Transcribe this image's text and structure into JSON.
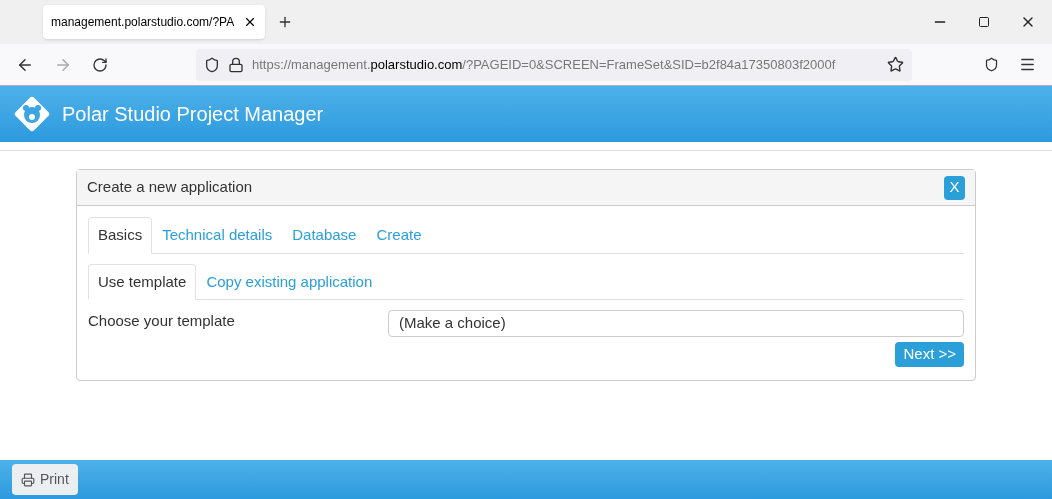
{
  "browser": {
    "tab_title": "management.polarstudio.com/?PA",
    "url": {
      "prefix": "https://management.",
      "domain": "polarstudio.com",
      "rest": "/?PAGEID=0&SCREEN=FrameSet&SID=b2f84a17350803f2000f"
    }
  },
  "header": {
    "title": "Polar Studio Project Manager"
  },
  "dialog": {
    "title": "Create a new application",
    "close": "X",
    "tabs": [
      {
        "label": "Basics",
        "selected": true
      },
      {
        "label": "Technical details",
        "selected": false
      },
      {
        "label": "Database",
        "selected": false
      },
      {
        "label": "Create",
        "selected": false
      }
    ],
    "subtabs": [
      {
        "label": "Use template",
        "selected": true
      },
      {
        "label": "Copy existing application",
        "selected": false
      }
    ],
    "field": {
      "label": "Choose your template",
      "value": "(Make a choice)"
    },
    "next": "Next >>"
  },
  "footer": {
    "print": "Print"
  }
}
